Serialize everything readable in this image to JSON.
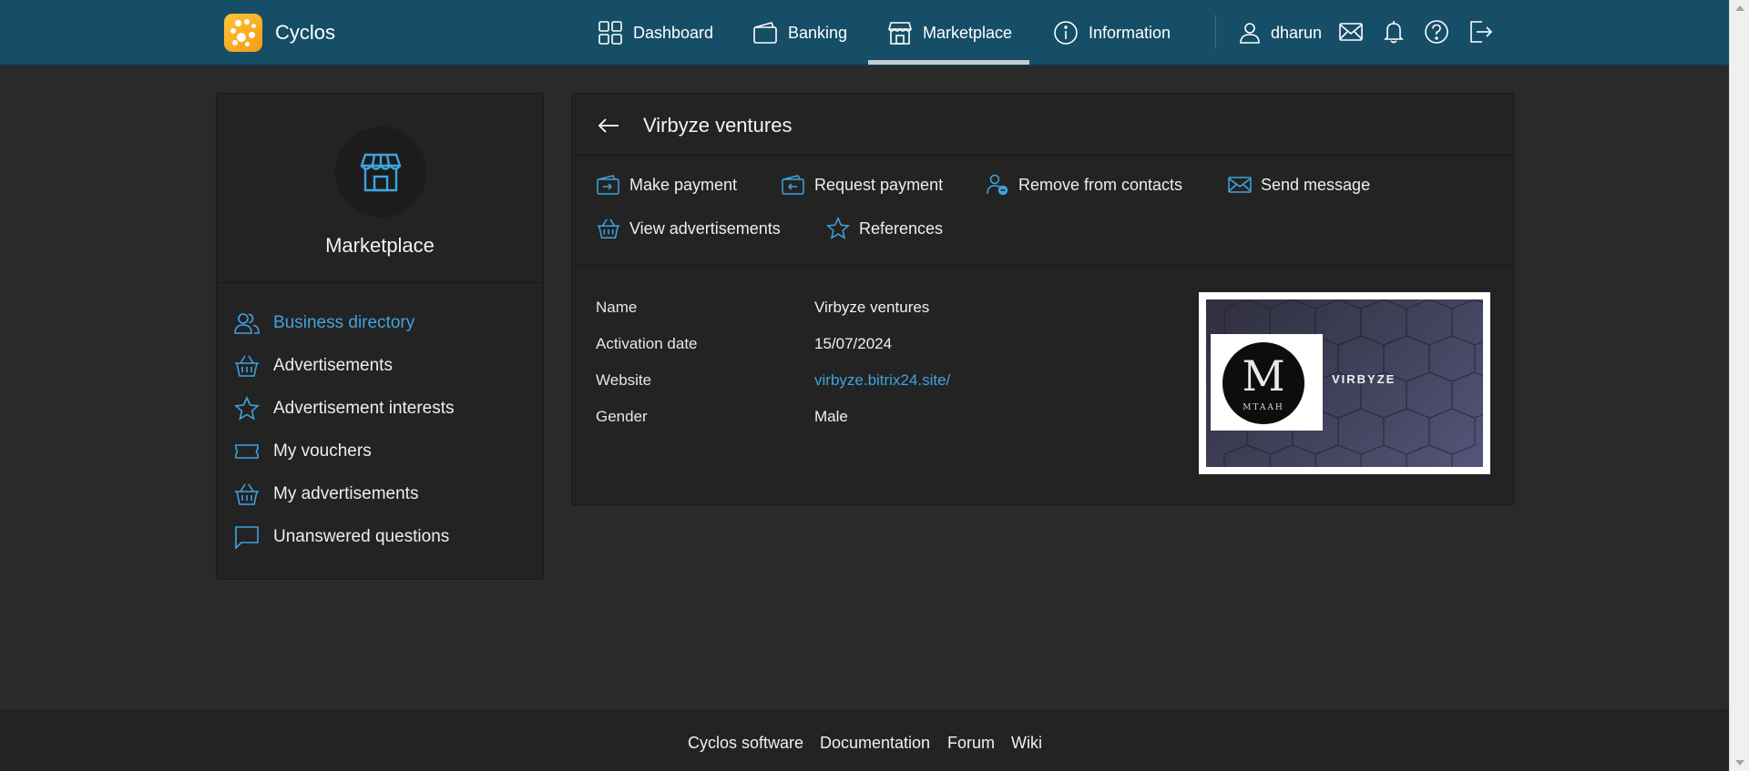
{
  "app": {
    "name": "Cyclos"
  },
  "nav": {
    "items": [
      {
        "label": "Dashboard"
      },
      {
        "label": "Banking"
      },
      {
        "label": "Marketplace"
      },
      {
        "label": "Information"
      }
    ],
    "active": "Marketplace",
    "user": "dharun"
  },
  "sidebar": {
    "title": "Marketplace",
    "items": [
      {
        "label": "Business directory",
        "active": true
      },
      {
        "label": "Advertisements"
      },
      {
        "label": "Advertisement interests"
      },
      {
        "label": "My vouchers"
      },
      {
        "label": "My advertisements"
      },
      {
        "label": "Unanswered questions"
      }
    ]
  },
  "profile": {
    "title": "Virbyze ventures",
    "actions": [
      {
        "label": "Make payment"
      },
      {
        "label": "Request payment"
      },
      {
        "label": "Remove from contacts"
      },
      {
        "label": "Send message"
      },
      {
        "label": "View advertisements"
      },
      {
        "label": "References"
      }
    ],
    "fields": [
      {
        "label": "Name",
        "value": "Virbyze ventures"
      },
      {
        "label": "Activation date",
        "value": "15/07/2024"
      },
      {
        "label": "Website",
        "value": "virbyze.bitrix24.site/"
      },
      {
        "label": "Gender",
        "value": "Male"
      }
    ],
    "image": {
      "logo_letter": "M",
      "logo_text": "MTAAH",
      "brand_text": "VIRBYZE"
    }
  },
  "footer": {
    "links": [
      {
        "label": "Cyclos software"
      },
      {
        "label": "Documentation"
      },
      {
        "label": "Forum"
      },
      {
        "label": "Wiki"
      }
    ]
  },
  "colors": {
    "topbar": "#154e66",
    "accent": "#3fa3df",
    "background": "#2a2a2a",
    "panel": "#232323"
  }
}
